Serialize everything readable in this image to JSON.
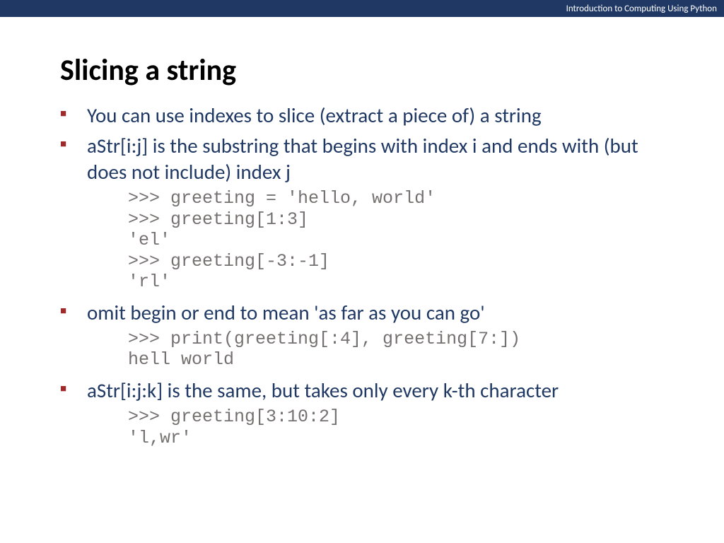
{
  "header": {
    "course_title": "Introduction to Computing Using Python"
  },
  "slide": {
    "title": "Slicing a string",
    "bullets": [
      {
        "text": "You can use indexes to slice (extract a piece of) a string",
        "code": null
      },
      {
        "text": "aStr[i:j] is the substring that begins with index i and ends with (but does not include) index j",
        "code": ">>> greeting = 'hello, world'\n>>> greeting[1:3]\n'el'\n>>> greeting[-3:-1]\n'rl'"
      },
      {
        "text": "omit begin or end to mean 'as far as you can go'",
        "code": ">>> print(greeting[:4], greeting[7:])\nhell world"
      },
      {
        "text": "aStr[i:j:k] is the same, but takes only every k-th character",
        "code": ">>> greeting[3:10:2]\n'l,wr'"
      }
    ]
  }
}
